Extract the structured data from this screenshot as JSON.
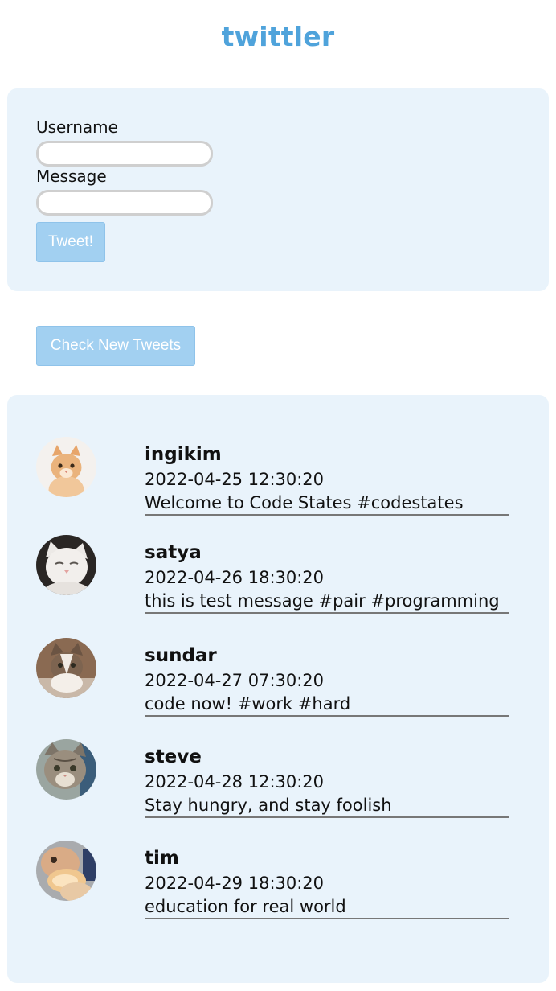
{
  "app": {
    "title": "twittler"
  },
  "form": {
    "username_label": "Username",
    "username_value": "",
    "message_label": "Message",
    "message_value": "",
    "submit_label": "Tweet!"
  },
  "feed": {
    "check_label": "Check New Tweets",
    "tweets": [
      {
        "username": "ingikim",
        "timestamp": "2022-04-25 12:30:20",
        "message": "Welcome to Code States #codestates",
        "avatar": "orange-cat-avatar"
      },
      {
        "username": "satya",
        "timestamp": "2022-04-26 18:30:20",
        "message": "this is test message #pair #programming",
        "avatar": "white-kitten-avatar"
      },
      {
        "username": "sundar",
        "timestamp": "2022-04-27 07:30:20",
        "message": "code now! #work #hard",
        "avatar": "tabby-cat-avatar"
      },
      {
        "username": "steve",
        "timestamp": "2022-04-28 12:30:20",
        "message": "Stay hungry, and stay foolish",
        "avatar": "grey-tabby-cat-avatar"
      },
      {
        "username": "tim",
        "timestamp": "2022-04-29 18:30:20",
        "message": "education for real world",
        "avatar": "cat-eating-bread-avatar"
      }
    ]
  },
  "colors": {
    "accent": "#4fa3db",
    "panel_bg": "#e9f3fb",
    "button_bg": "#a2d0f1"
  }
}
